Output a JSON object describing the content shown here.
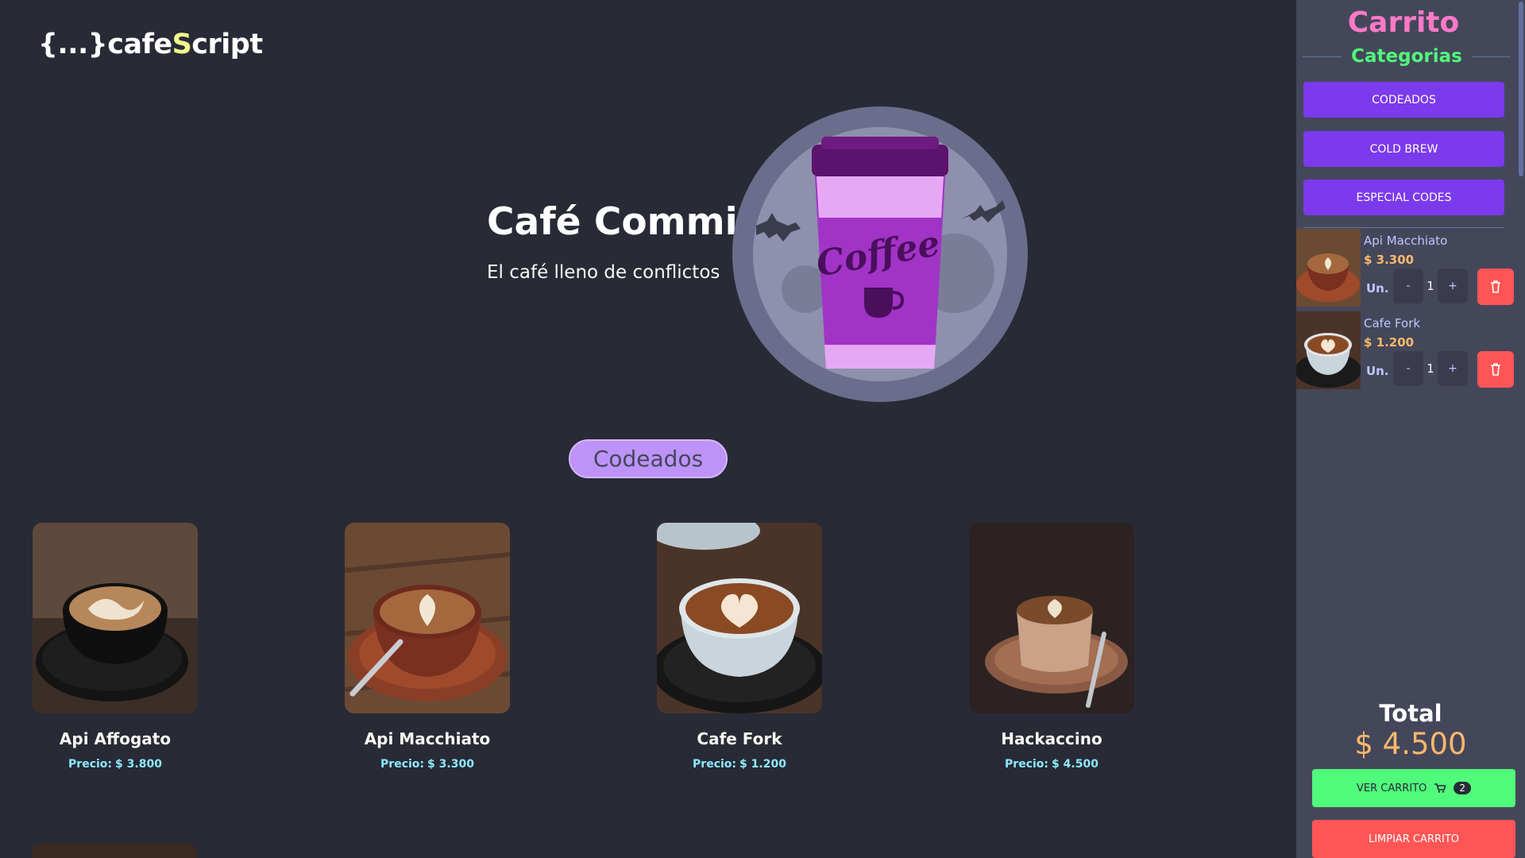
{
  "header": {
    "logo_prefix": "{...}cafe",
    "logo_accent": "S",
    "logo_suffix": "cript"
  },
  "hero": {
    "title": "Café Commit",
    "subtitle": "El café lleno de conflictos",
    "art_text": "Coffee"
  },
  "section": {
    "title": "Codeados"
  },
  "products": [
    {
      "name": "Api Affogato",
      "price_label": "Precio:",
      "price": "$ 3.800"
    },
    {
      "name": "Api Macchiato",
      "price_label": "Precio:",
      "price": "$ 3.300"
    },
    {
      "name": "Cafe Fork",
      "price_label": "Precio:",
      "price": "$ 1.200"
    },
    {
      "name": "Hackaccino",
      "price_label": "Precio:",
      "price": "$ 4.500"
    }
  ],
  "sidebar": {
    "title": "Carrito",
    "categories_title": "Categorias",
    "categories": [
      "CODEADOS",
      "COLD BREW",
      "ESPECIAL CODES"
    ],
    "cart_items": [
      {
        "name": "Api Macchiato",
        "price": "$ 3.300",
        "unit_label": "Un.",
        "qty": "1",
        "minus": "-",
        "plus": "+"
      },
      {
        "name": "Cafe Fork",
        "price": "$ 1.200",
        "unit_label": "Un.",
        "qty": "1",
        "minus": "-",
        "plus": "+"
      }
    ],
    "total_label": "Total",
    "total_value": "$ 4.500",
    "view_cart_label": "VER CARRITO",
    "cart_count": "2",
    "clear_cart_label": "LIMPIAR CARRITO"
  },
  "colors": {
    "background": "#282a36",
    "sidebar": "#44475a",
    "accent_purple": "#7c3aed",
    "pill": "#bd93f9",
    "green": "#50fa7b",
    "red": "#ff5555",
    "pink": "#ff79c6",
    "orange": "#ffb86c",
    "cyan": "#8be9fd"
  }
}
